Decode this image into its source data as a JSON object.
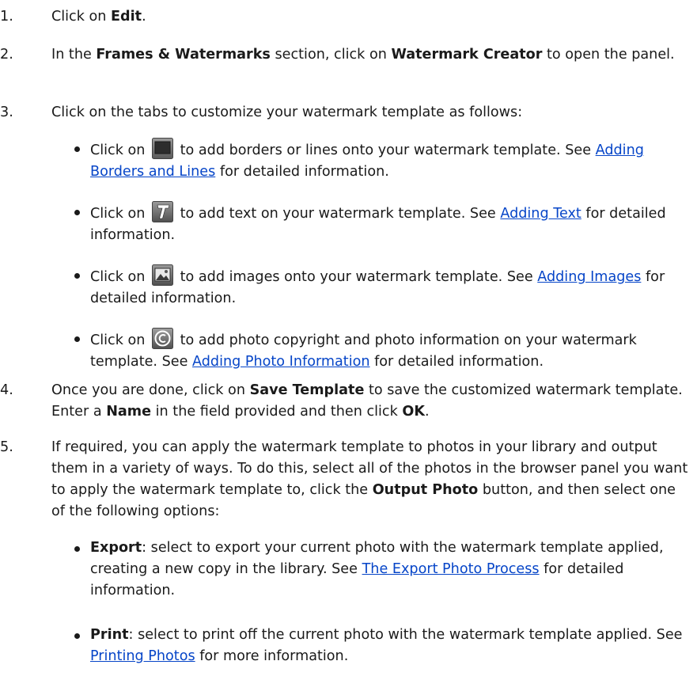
{
  "steps": [
    {
      "num": "1.",
      "pre": "Click on ",
      "bold": "Edit",
      "post": "."
    },
    {
      "num": "2.",
      "pre": "In the ",
      "bold1": "Frames & Watermarks",
      "mid": " section, click on ",
      "bold2": "Watermark Creator",
      "post": " to open the panel."
    },
    {
      "num": "3.",
      "text": "Click on the tabs to customize your watermark template as follows:"
    },
    {
      "num": "4.",
      "pre": "Once you are done, click on ",
      "bold1": "Save Template",
      "mid": " to save the customized watermark template. Enter a ",
      "bold2": "Name",
      "mid2": " in the field provided and then click ",
      "bold3": "OK",
      "post": "."
    },
    {
      "num": "5.",
      "pre": "If required, you can apply the watermark template to photos in your library and output them in a variety of ways. To do this, select all of the photos in the browser panel you want to apply the watermark template to, click the ",
      "bold": "Output Photo",
      "post": " button, and then select one of the following options:"
    }
  ],
  "tab_bullets": [
    {
      "pre": "Click on ",
      "icon": "borders-tab-icon",
      "mid": " to add borders or lines onto your watermark template. See ",
      "link": "Adding Borders and Lines",
      "post": " for detailed information."
    },
    {
      "pre": "Click on ",
      "icon": "text-tab-icon",
      "mid": " to add text on your watermark template. See ",
      "link": "Adding Text",
      "post": " for detailed information."
    },
    {
      "pre": "Click on ",
      "icon": "images-tab-icon",
      "mid": " to add images onto your watermark template. See ",
      "link": "Adding Images",
      "post": " for detailed information."
    },
    {
      "pre": "Click on ",
      "icon": "copyright-tab-icon",
      "mid": " to add photo copyright and photo information on your watermark template. See ",
      "link": "Adding Photo Information",
      "post": " for detailed information."
    }
  ],
  "output_bullets": [
    {
      "bold": "Export",
      "mid": ": select to export your current photo with the watermark template applied, creating a new copy in the library. See ",
      "link": "The Export Photo Process",
      "post": " for detailed information."
    },
    {
      "bold": "Print",
      "mid": ": select to print off the current photo with the watermark template applied. See ",
      "link": "Printing Photos",
      "post": " for more information."
    }
  ],
  "colors": {
    "link": "#0645c8",
    "text": "#1a1a1a",
    "icon_bg": "#6b6b6b"
  }
}
